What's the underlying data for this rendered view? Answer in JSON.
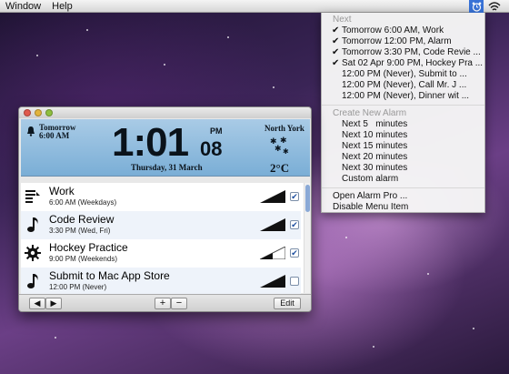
{
  "menubar": {
    "items": [
      "Window",
      "Help"
    ],
    "status_icon": "alarm-clock-icon",
    "wifi_icon": "wifi-icon"
  },
  "status_menu": {
    "next_header": "Next",
    "next_items": [
      {
        "label": "Tomorrow 6:00 AM, Work",
        "checked": true
      },
      {
        "label": "Tomorrow 12:00 PM, Alarm",
        "checked": true
      },
      {
        "label": "Tomorrow 3:30 PM, Code Revie ...",
        "checked": true
      },
      {
        "label": "Sat 02 Apr 9:00 PM, Hockey Pra ...",
        "checked": true
      },
      {
        "label": "12:00 PM (Never), Submit to ...",
        "checked": false
      },
      {
        "label": "12:00 PM (Never), Call Mr. J ...",
        "checked": false
      },
      {
        "label": "12:00 PM (Never), Dinner wit ...",
        "checked": false
      }
    ],
    "create_header": "Create New Alarm",
    "create_items": [
      "Next 5   minutes",
      "Next 10 minutes",
      "Next 15 minutes",
      "Next 20 minutes",
      "Next 30 minutes",
      "Custom alarm"
    ],
    "actions": [
      "Open Alarm Pro ...",
      "Disable Menu Item"
    ]
  },
  "clock": {
    "next_label": "Tomorrow",
    "next_time": "6:00 AM",
    "time": "1:01",
    "ampm": "PM",
    "seconds": "08",
    "date": "Thursday, 31 March",
    "city": "North York",
    "temperature": "2°C",
    "weather_icon": "snow-icon"
  },
  "alarms": [
    {
      "name": "Work",
      "schedule": "6:00 AM (Weekdays)",
      "icon": "list-icon",
      "enabled": true,
      "volume": 1.0
    },
    {
      "name": "Code Review",
      "schedule": "3:30 PM (Wed, Fri)",
      "icon": "music-note-icon",
      "enabled": true,
      "volume": 1.0
    },
    {
      "name": "Hockey Practice",
      "schedule": "9:00 PM (Weekends)",
      "icon": "gear-icon",
      "enabled": true,
      "volume": 0.5
    },
    {
      "name": "Submit to Mac App Store",
      "schedule": "12:00 PM (Never)",
      "icon": "music-note-icon",
      "enabled": false,
      "volume": 1.0
    }
  ],
  "toolbar": {
    "prev_label": "◀",
    "next_label": "▶",
    "add_label": "+",
    "remove_label": "−",
    "edit_label": "Edit"
  },
  "colors": {
    "menu_highlight": "#3872d6",
    "clock_panel": "#8fbce0",
    "checkbox": "#1d4fa0"
  }
}
